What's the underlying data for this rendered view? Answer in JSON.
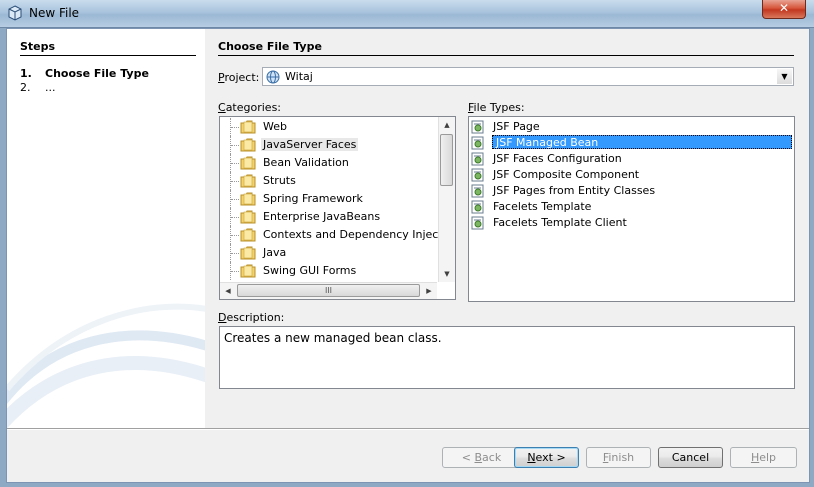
{
  "window": {
    "title": "New File",
    "close_glyph": "✕"
  },
  "steps": {
    "heading": "Steps",
    "items": [
      {
        "num": "1.",
        "label": "Choose File Type"
      },
      {
        "num": "2.",
        "label": "..."
      }
    ]
  },
  "main": {
    "heading": "Choose File Type",
    "project_label": "Project:",
    "project_value": "Witaj",
    "categories_label": "Categories:",
    "file_types_label": "File Types:",
    "categories": [
      "Web",
      "JavaServer Faces",
      "Bean Validation",
      "Struts",
      "Spring Framework",
      "Enterprise JavaBeans",
      "Contexts and Dependency Injection",
      "Java",
      "Swing GUI Forms"
    ],
    "selected_category": "JavaServer Faces",
    "file_types": [
      "JSF Page",
      "JSF Managed Bean",
      "JSF Faces Configuration",
      "JSF Composite Component",
      "JSF Pages from Entity Classes",
      "Facelets Template",
      "Facelets Template Client"
    ],
    "selected_file_type": "JSF Managed Bean",
    "description_label": "Description:",
    "description": "Creates a new managed bean class.",
    "scroll_grip": "III"
  },
  "buttons": {
    "back": "< Back",
    "next": "Next >",
    "finish": "Finish",
    "cancel": "Cancel",
    "help": "Help"
  },
  "icons": {
    "app": "netbeans-cube-icon",
    "project": "globe-icon",
    "category": "folder-icon",
    "file_type": "jsf-file-icon"
  },
  "colors": {
    "selection": "#3399ff",
    "close": "#c2371f"
  }
}
